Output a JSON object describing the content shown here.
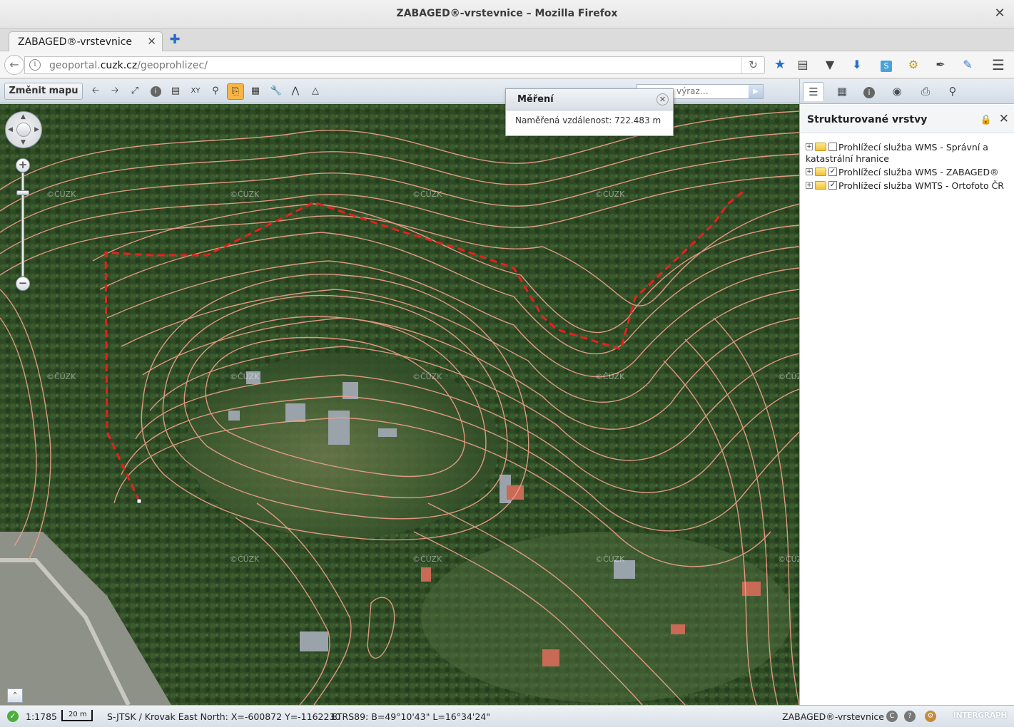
{
  "window": {
    "title": "ZABAGED®-vrstevnice – Mozilla Firefox",
    "close_glyph": "✕"
  },
  "tab": {
    "label": "ZABAGED®-vrstevnice",
    "close_glyph": "✕",
    "new_glyph": "✚"
  },
  "nav": {
    "url_plain_1": "geoportal.",
    "url_host": "cuzk.cz",
    "url_plain_2": "/geoprohlizec/",
    "icons": [
      "star-icon",
      "reading-list-icon",
      "pocket-icon",
      "download-icon",
      "extension-s-icon",
      "key-icon",
      "feather-icon",
      "notes-icon",
      "menu-icon"
    ]
  },
  "toolbar": {
    "change_map": "Změnit mapu",
    "search_placeholder": "výraz…",
    "buttons": [
      "back-icon",
      "forward-icon",
      "full-extent-icon",
      "info-icon",
      "legend-icon",
      "zoom-box-icon",
      "zoom-scale-icon",
      "measure-distance-icon",
      "measure-area-icon",
      "tools-icon",
      "profile-icon",
      "sightline-icon"
    ]
  },
  "measurement": {
    "title": "Měření",
    "text": "Naměřená vzdálenost: 722.483 m"
  },
  "map": {
    "watermark": "©ČÚZK"
  },
  "panel": {
    "title": "Strukturované vrstvy",
    "tabs": [
      "layers-icon",
      "grid-icon",
      "info-icon",
      "globe-icon",
      "print-icon",
      "search-icon"
    ],
    "layers": [
      {
        "label": "Prohlížecí služba WMS - Správní a",
        "label2": "katastrální hranice",
        "checked": false
      },
      {
        "label": "Prohlížecí služba WMS - ZABAGED®",
        "checked": true
      },
      {
        "label": "Prohlížecí služba WMTS - Ortofoto ČR",
        "checked": true
      }
    ]
  },
  "status": {
    "scale": "1:1785",
    "scalebar": "20 m",
    "coords": "S-JTSK / Krovak East North: X=-600872 Y=-1162230",
    "etrs": "ETRS89: B=49°10'43\" L=16°34'24\"",
    "layer": "ZABAGED®-vrstevnice",
    "brand": "INTERGRAPH"
  }
}
